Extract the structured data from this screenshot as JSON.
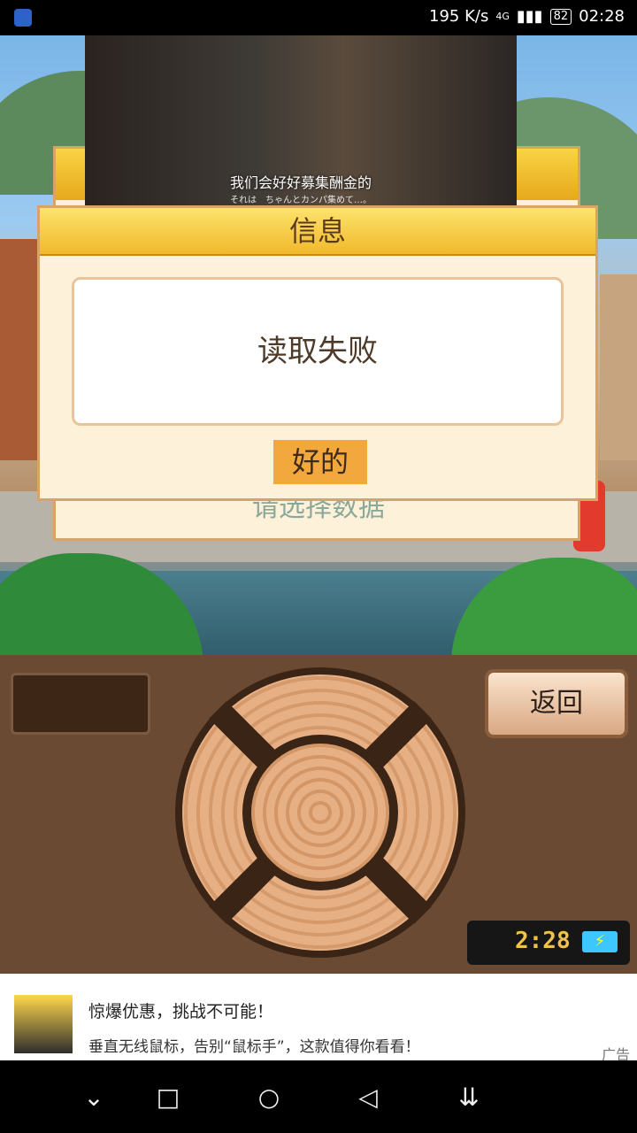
{
  "status_bar": {
    "speed": "195 K/s",
    "network": "4G",
    "battery": "82",
    "time": "02:28"
  },
  "video": {
    "subtitle_cn": "我们会好好募集酬金的",
    "subtitle_jp": "それは　ちゃんとカンパ集めて…。"
  },
  "background_panel": {
    "select_data_label": "请选择数据"
  },
  "dialog": {
    "title": "信息",
    "message": "读取失败",
    "ok_label": "好的"
  },
  "controls": {
    "back_label": "返回",
    "timer": "2:28",
    "charge_symbol": "⚡"
  },
  "ad": {
    "title": "惊爆优惠，挑战不可能！",
    "description": "垂直无线鼠标，告别“鼠标手”，这款值得你看看！",
    "tag": "广告"
  },
  "nav_bar": {
    "down": "⌄",
    "recents": "□",
    "home": "○",
    "back": "◁",
    "notifications": "⇊"
  }
}
